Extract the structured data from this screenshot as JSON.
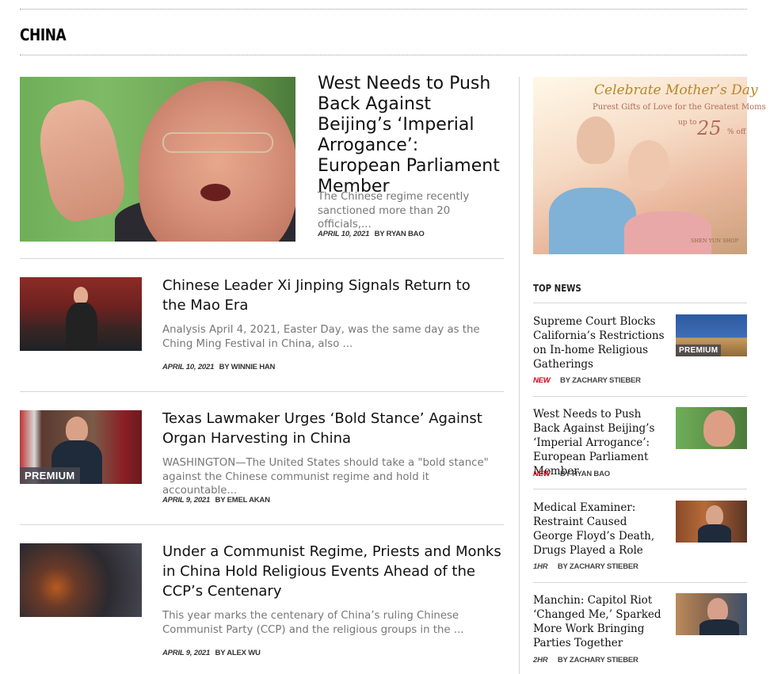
{
  "section": {
    "title": "CHINA"
  },
  "featured": {
    "headline": "West Needs to Push Back Against Beijing’s ‘Imperial Arrogance’: European Parliament Member",
    "excerpt": "The Chinese regime recently sanctioned more than 20 officials,...",
    "date": "APRIL 10, 2021",
    "byline": "BY RYAN BAO"
  },
  "articles": [
    {
      "headline": "Chinese Leader Xi Jinping Signals Return to the Mao Era",
      "excerpt": "Analysis April 4, 2021, Easter Day, was the same day as the Ching Ming Festival in China, also ...",
      "date": "APRIL 10, 2021",
      "byline": "BY WINNIE HAN",
      "premium": ""
    },
    {
      "headline": "Texas Lawmaker Urges ‘Bold Stance’ Against Organ Harvesting in China",
      "excerpt": "WASHINGTON—The United States should take a \"bold stance\" against the Chinese communist regime and hold it accountable...",
      "date": "APRIL 9, 2021",
      "byline": "BY EMEL AKAN",
      "premium": "PREMIUM"
    },
    {
      "headline": "Under a Communist Regime, Priests and Monks in China Hold Religious Events Ahead of the CCP’s Centenary",
      "excerpt": "This year marks the centenary of China’s ruling Chinese Communist Party (CCP) and the religious groups in the ...",
      "date": "APRIL 9, 2021",
      "byline": "BY ALEX WU",
      "premium": ""
    }
  ],
  "ad": {
    "headline": "Celebrate Mother’s Day",
    "subline": "Purest Gifts of Love for the Greatest Moms",
    "upto": "up to",
    "percent": "25",
    "off": "% off",
    "shop": "SHEN YUN SHOP"
  },
  "sidebar": {
    "title": "TOP NEWS",
    "items": [
      {
        "headline": "Supreme Court Blocks California’s Restrictions on In-home Religious Gatherings",
        "tag": "NEW",
        "byline": "BY ZACHARY STIEBER",
        "premium": "PREMIUM"
      },
      {
        "headline": "West Needs to Push Back Against Beijing’s ‘Imperial Arrogance’: European Parliament Member",
        "tag": "NEW",
        "byline": "BY RYAN BAO",
        "premium": ""
      },
      {
        "headline": "Medical Examiner: Restraint Caused George Floyd’s Death, Drugs Played a Role",
        "tag": "1HR",
        "byline": "BY ZACHARY STIEBER",
        "premium": ""
      },
      {
        "headline": "Manchin: Capitol Riot ‘Changed Me,’ Sparked More Work Bringing Parties Together",
        "tag": "2HR",
        "byline": "BY ZACHARY STIEBER",
        "premium": ""
      }
    ]
  },
  "colors": {
    "new_tag": "#d0021b",
    "excerpt": "#777777",
    "premium_bg": "#464650"
  }
}
